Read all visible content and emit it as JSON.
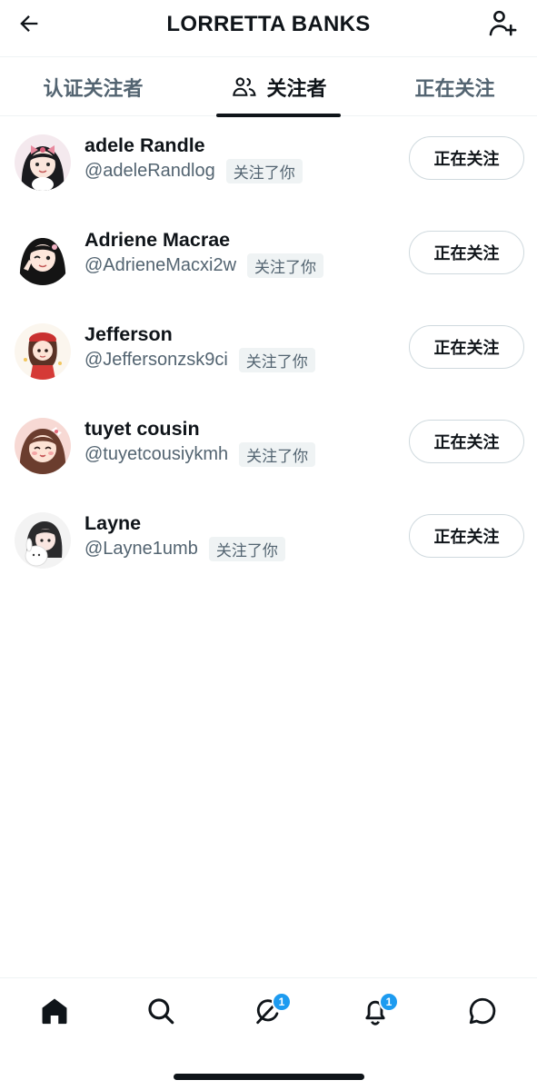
{
  "header": {
    "title": "LORRETTA BANKS"
  },
  "tabs": [
    {
      "label": "认证关注者"
    },
    {
      "label": "关注者"
    },
    {
      "label": "正在关注"
    }
  ],
  "users": [
    {
      "name": "adele Randle",
      "handle": "@adeleRandlog",
      "follows_you": "关注了你",
      "button": "正在关注"
    },
    {
      "name": "Adriene Macrae",
      "handle": "@AdrieneMacxi2w",
      "follows_you": "关注了你",
      "button": "正在关注"
    },
    {
      "name": "Jefferson",
      "handle": "@Jeffersonzsk9ci",
      "follows_you": "关注了你",
      "button": "正在关注"
    },
    {
      "name": "tuyet cousin",
      "handle": "@tuyetcousiykmh",
      "follows_you": "关注了你",
      "button": "正在关注"
    },
    {
      "name": "Layne",
      "handle": "@Layne1umb",
      "follows_you": "关注了你",
      "button": "正在关注"
    }
  ],
  "bottom_nav": {
    "items": [
      {
        "icon": "home-icon"
      },
      {
        "icon": "search-icon"
      },
      {
        "icon": "grok-icon",
        "badge": "1"
      },
      {
        "icon": "bell-icon",
        "badge": "1"
      },
      {
        "icon": "chat-icon"
      }
    ]
  },
  "colors": {
    "text_primary": "#0f1419",
    "text_secondary": "#536471",
    "badge_blue": "#1d9bf0",
    "divider": "#eff3f4"
  }
}
